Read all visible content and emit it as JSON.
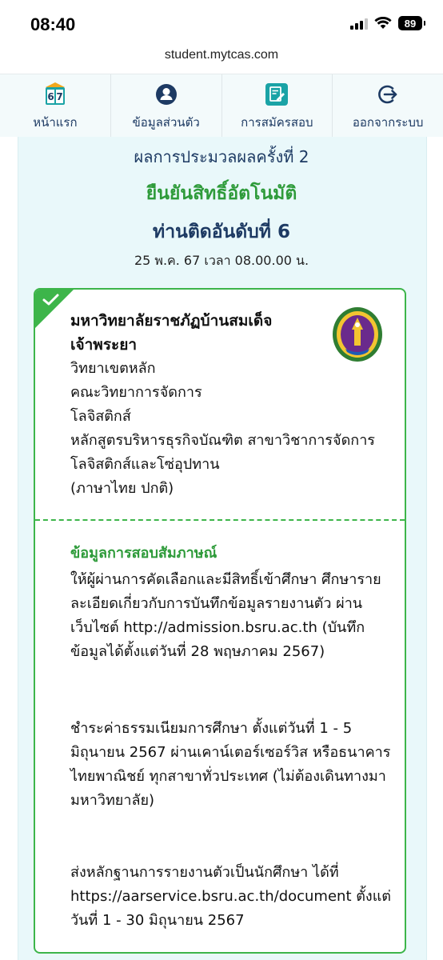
{
  "status_bar": {
    "time": "08:40",
    "battery": "89"
  },
  "url": "student.mytcas.com",
  "nav": [
    {
      "label": "หน้าแรก",
      "icon": "calendar-67-icon"
    },
    {
      "label": "ข้อมูลส่วนตัว",
      "icon": "user-icon"
    },
    {
      "label": "การสมัครสอบ",
      "icon": "edit-document-icon"
    },
    {
      "label": "ออกจากระบบ",
      "icon": "logout-icon"
    }
  ],
  "nav_icon_text": "6 7",
  "result": {
    "round_title": "ผลการประมวลผลครั้งที่ 2",
    "confirm_title": "ยืนยันสิทธิ์อัตโนมัติ",
    "rank_title": "ท่านติดอันดับที่ 6",
    "datetime": "25 พ.ค. 67 เวลา 08.00.00 น."
  },
  "card": {
    "university_line1": "มหาวิทยาลัยราชภัฏบ้านสมเด็จ",
    "university_line2": "เจ้าพระยา",
    "campus": "วิทยาเขตหลัก",
    "faculty": "คณะวิทยาการจัดการ",
    "major": "โลจิสติกส์",
    "program": "หลักสูตรบริหารธุรกิจบัณฑิต สาขาวิชาการจัดการโลจิสติกส์และโซ่อุปทาน",
    "language": "(ภาษาไทย ปกติ)",
    "info_title": "ข้อมูลการสอบสัมภาษณ์",
    "paragraphs": [
      "ให้ผู้ผ่านการคัดเลือกและมีสิทธิ์เข้าศึกษา ศึกษารายละเอียดเกี่ยวกับการบันทึกข้อมูลรายงานตัว ผ่านเว็บไซต์ http://admission.bsru.ac.th (บันทึกข้อมูลได้ตั้งแต่วันที่ 28 พฤษภาคม 2567)",
      "ชำระค่าธรรมเนียมการศึกษา ตั้งแต่วันที่ 1 - 5 มิถุนายน 2567 ผ่านเคาน์เตอร์เซอร์วิส หรือธนาคารไทยพาณิชย์ ทุกสาขาทั่วประเทศ (ไม่ต้องเดินทางมามหาวิทยาลัย)",
      "ส่งหลักฐานการรายงานตัวเป็นนักศึกษา ได้ที่ https://aarservice.bsru.ac.th/document ตั้งแต่วันที่ 1 - 30 มิถุนายน 2567"
    ]
  },
  "colors": {
    "accent_green": "#3db54a",
    "navy": "#1d3a63",
    "teal": "#1aa3a6",
    "panel_bg": "#e9f8fa"
  }
}
